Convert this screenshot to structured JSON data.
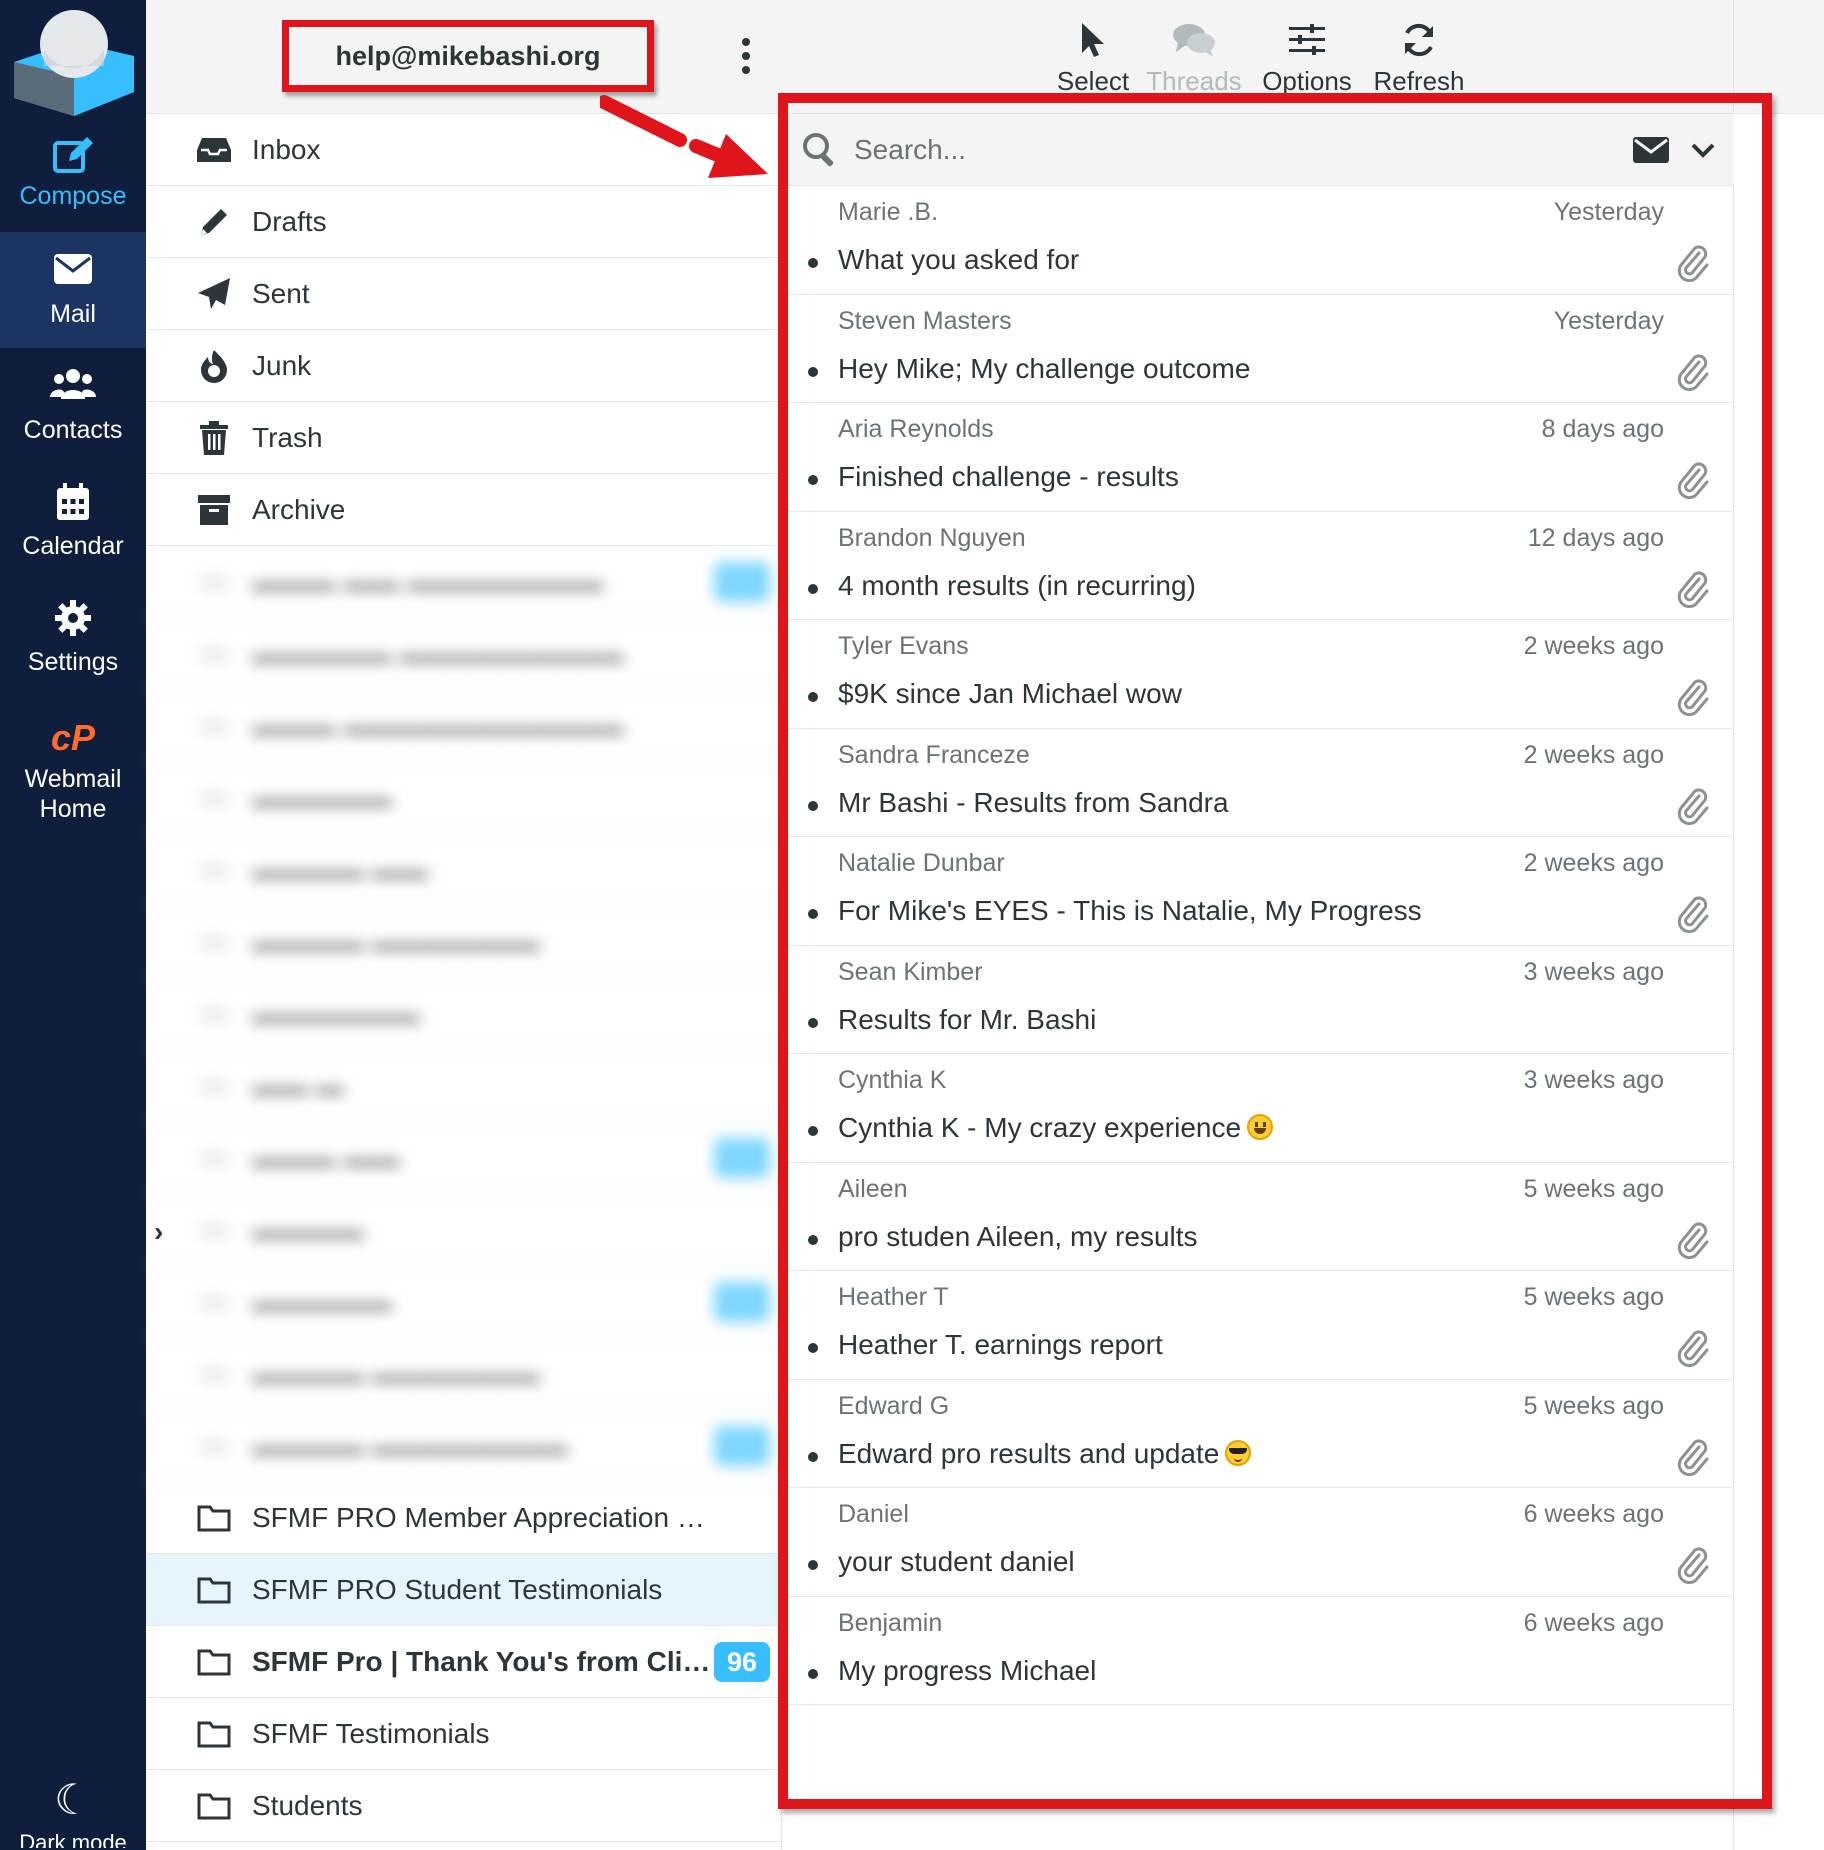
{
  "nav": {
    "compose": "Compose",
    "mail": "Mail",
    "contacts": "Contacts",
    "calendar": "Calendar",
    "settings": "Settings",
    "webmail_line1": "Webmail",
    "webmail_line2": "Home",
    "dark_mode": "Dark mode",
    "accent_color": "#37beff",
    "bg_color": "#0f1e3d"
  },
  "account": {
    "email": "help@mikebashi.org"
  },
  "folders": {
    "standard": [
      {
        "label": "Inbox",
        "icon": "inbox-icon"
      },
      {
        "label": "Drafts",
        "icon": "pencil-icon"
      },
      {
        "label": "Sent",
        "icon": "paper-plane-icon"
      },
      {
        "label": "Junk",
        "icon": "fire-icon"
      },
      {
        "label": "Trash",
        "icon": "trash-icon"
      },
      {
        "label": "Archive",
        "icon": "archive-icon"
      }
    ],
    "custom": [
      {
        "label": "SFMF PRO Member Appreciation Emails"
      },
      {
        "label": "SFMF PRO Student Testimonials"
      },
      {
        "label": "SFMF Pro | Thank You's from Clien...",
        "badge": "96"
      },
      {
        "label": "SFMF Testimonials"
      },
      {
        "label": "Students"
      }
    ]
  },
  "toolbar": {
    "select": "Select",
    "threads": "Threads",
    "options": "Options",
    "refresh": "Refresh"
  },
  "search": {
    "placeholder": "Search..."
  },
  "messages": [
    {
      "sender": "Marie .B.",
      "date": "Yesterday",
      "subject": "What you asked for",
      "attachment": true
    },
    {
      "sender": "Steven Masters",
      "date": "Yesterday",
      "subject": "Hey Mike; My challenge outcome",
      "attachment": true
    },
    {
      "sender": "Aria Reynolds",
      "date": "8 days ago",
      "subject": "Finished challenge - results",
      "attachment": true
    },
    {
      "sender": "Brandon Nguyen",
      "date": "12 days ago",
      "subject": "4 month results (in recurring)",
      "attachment": true
    },
    {
      "sender": "Tyler Evans",
      "date": "2 weeks ago",
      "subject": "$9K since Jan Michael wow",
      "attachment": true
    },
    {
      "sender": "Sandra Franceze",
      "date": "2 weeks ago",
      "subject": "Mr Bashi - Results from Sandra",
      "attachment": true
    },
    {
      "sender": "Natalie Dunbar",
      "date": "2 weeks ago",
      "subject": "For Mike's EYES - This is Natalie, My Progress",
      "attachment": true
    },
    {
      "sender": "Sean Kimber",
      "date": "3 weeks ago",
      "subject": "Results for Mr. Bashi",
      "attachment": false
    },
    {
      "sender": "Cynthia K",
      "date": "3 weeks ago",
      "subject": "Cynthia K - My crazy experience",
      "attachment": false,
      "emoji": "grin"
    },
    {
      "sender": "Aileen",
      "date": "5 weeks ago",
      "subject": "pro studen Aileen, my results",
      "attachment": true
    },
    {
      "sender": "Heather T",
      "date": "5 weeks ago",
      "subject": "Heather T. earnings report",
      "attachment": true
    },
    {
      "sender": "Edward G",
      "date": "5 weeks ago",
      "subject": "Edward pro results and update",
      "attachment": true,
      "emoji": "cool"
    },
    {
      "sender": "Daniel",
      "date": "6 weeks ago",
      "subject": "your student daniel",
      "attachment": true
    },
    {
      "sender": "Benjamin",
      "date": "6 weeks ago",
      "subject": "My progress Michael",
      "attachment": false
    }
  ],
  "annotation_color": "#e0141b"
}
